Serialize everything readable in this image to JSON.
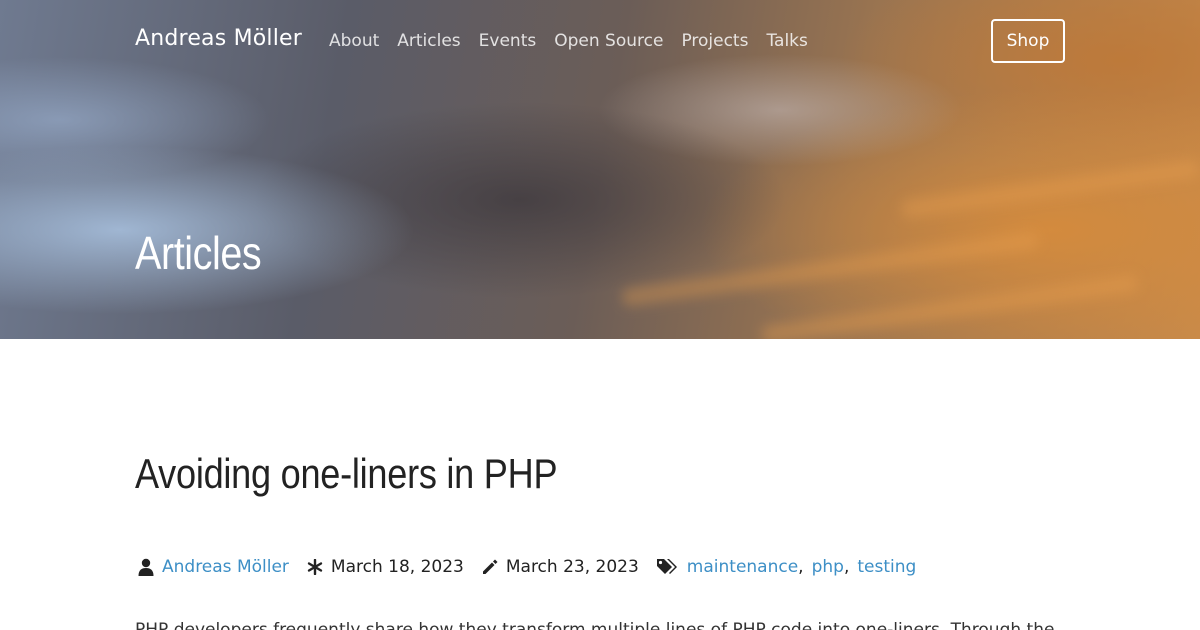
{
  "header": {
    "brand": "Andreas Möller",
    "nav": [
      "About",
      "Articles",
      "Events",
      "Open Source",
      "Projects",
      "Talks"
    ],
    "shop_label": "Shop"
  },
  "hero": {
    "title": "Articles"
  },
  "article": {
    "title": "Avoiding one-liners in PHP",
    "author": "Andreas Möller",
    "published": "March 18, 2023",
    "updated": "March 23, 2023",
    "tags": [
      "maintenance",
      "php",
      "testing"
    ],
    "excerpt": "PHP developers frequently share how they transform multiple lines of PHP code into one-liners. Through the"
  },
  "icons": {
    "author": "user-icon",
    "published": "asterisk-icon",
    "updated": "pencil-icon",
    "tags": "tags-icon"
  },
  "colors": {
    "link": "#3d8fc6",
    "text": "#222222",
    "hero_text": "#ffffff"
  }
}
